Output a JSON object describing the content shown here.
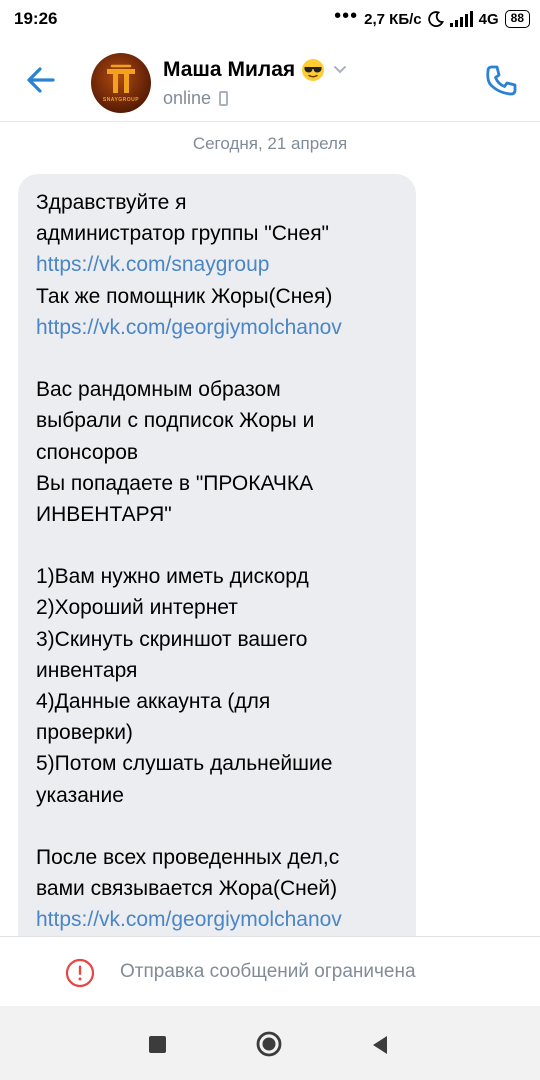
{
  "status_bar": {
    "time": "19:26",
    "dots": "•••",
    "speed": "2,7 КБ/с",
    "network": "4G",
    "network_sub": "ıl",
    "battery": "88"
  },
  "header": {
    "contact_name": "Маша Милая",
    "status": "online",
    "avatar_text": "SNAYGROUP"
  },
  "chat": {
    "date_separator": "Сегодня, 21 апреля",
    "message_lines": [
      {
        "text": "Здравствуйте я",
        "link": false
      },
      {
        "text": "администратор группы \"Снея\"",
        "link": false
      },
      {
        "text": "https://vk.com/snaygroup",
        "link": true
      },
      {
        "text": "Так же помощник Жоры(Снея)",
        "link": false
      },
      {
        "text": "https://vk.com/georgiymolchanov",
        "link": true
      },
      {
        "text": "",
        "link": false
      },
      {
        "text": "Вас рандомным образом",
        "link": false
      },
      {
        "text": "выбрали с подписок Жоры и",
        "link": false
      },
      {
        "text": "спонсоров",
        "link": false
      },
      {
        "text": "Вы попадаете в \"ПРОКАЧКА",
        "link": false
      },
      {
        "text": "ИНВЕНТАРЯ\"",
        "link": false
      },
      {
        "text": "",
        "link": false
      },
      {
        "text": "1)Вам нужно иметь дискорд",
        "link": false
      },
      {
        "text": "2)Хороший интернет",
        "link": false
      },
      {
        "text": "3)Скинуть скриншот вашего",
        "link": false
      },
      {
        "text": "инвентаря",
        "link": false
      },
      {
        "text": "4)Данные аккаунта (для",
        "link": false
      },
      {
        "text": "проверки)",
        "link": false
      },
      {
        "text": "5)Потом слушать дальнейшие",
        "link": false
      },
      {
        "text": "указание",
        "link": false
      },
      {
        "text": "",
        "link": false
      },
      {
        "text": "После всех проведенных дел,с",
        "link": false
      },
      {
        "text": "вами связывается Жора(Сней)",
        "link": false
      },
      {
        "text": "https://vk.com/georgiymolchanov",
        "link": true
      }
    ]
  },
  "restriction": {
    "text": "Отправка сообщений ограничена"
  },
  "colors": {
    "accent": "#2a82d6",
    "link": "#4a86c5",
    "bubble": "#ebedf0",
    "secondary_text": "#818c99",
    "warning": "#e64646"
  },
  "icons": {
    "back": "arrow-left-icon",
    "call": "phone-icon",
    "emoji": "sunglasses-emoji-icon",
    "warning": "exclamation-circle-icon"
  }
}
